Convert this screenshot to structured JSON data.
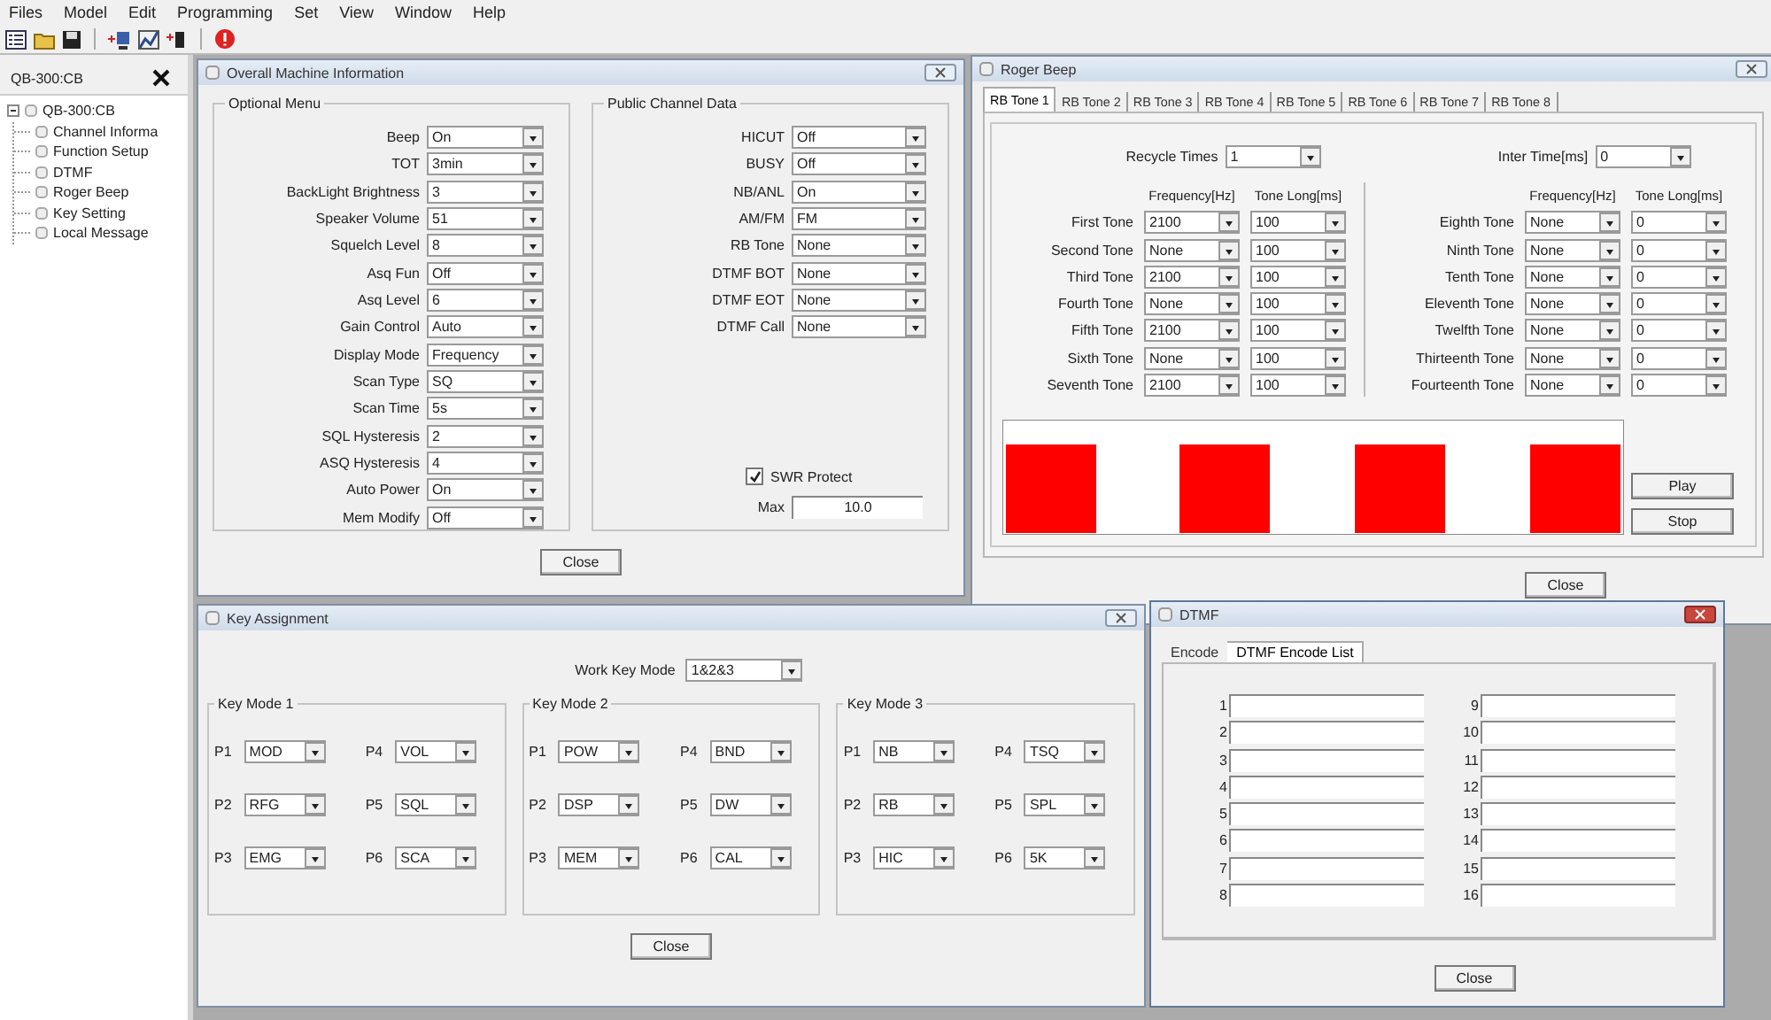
{
  "menu": [
    "Files",
    "Model",
    "Edit",
    "Programming",
    "Set",
    "View",
    "Window",
    "Help"
  ],
  "tree_panel": {
    "title": "QB-300:CB",
    "tree": [
      {
        "label": "QB-300:CB",
        "expanded": true,
        "children": [
          {
            "label": "Channel Informa"
          },
          {
            "label": "Function Setup"
          },
          {
            "label": "DTMF"
          },
          {
            "label": "Roger Beep"
          },
          {
            "label": "Key Setting"
          },
          {
            "label": "Local Message"
          }
        ]
      }
    ]
  },
  "machine_info": {
    "title": "Overall Machine Information",
    "active": false,
    "optional_menu": {
      "title": "Optional Menu",
      "fields": [
        {
          "label": "Beep",
          "value": "On"
        },
        {
          "label": "TOT",
          "value": "3min"
        },
        {
          "label": "BackLight Brightness",
          "value": "3"
        },
        {
          "label": "Speaker Volume",
          "value": "51"
        },
        {
          "label": "Squelch Level",
          "value": "8"
        },
        {
          "label": "Asq Fun",
          "value": "Off"
        },
        {
          "label": "Asq Level",
          "value": "6"
        },
        {
          "label": "Gain Control",
          "value": "Auto"
        },
        {
          "label": "Display Mode",
          "value": "Frequency"
        },
        {
          "label": "Scan Type",
          "value": "SQ"
        },
        {
          "label": "Scan Time",
          "value": "5s"
        },
        {
          "label": "SQL Hysteresis",
          "value": "2"
        },
        {
          "label": "ASQ Hysteresis",
          "value": "4"
        },
        {
          "label": "Auto Power",
          "value": "On"
        },
        {
          "label": "Mem Modify",
          "value": "Off"
        }
      ]
    },
    "public_channel": {
      "title": "Public Channel Data",
      "fields": [
        {
          "label": "HICUT",
          "value": "Off"
        },
        {
          "label": "BUSY",
          "value": "Off"
        },
        {
          "label": "NB/ANL",
          "value": "On"
        },
        {
          "label": "AM/FM",
          "value": "FM"
        },
        {
          "label": "RB Tone",
          "value": "None"
        },
        {
          "label": "DTMF BOT",
          "value": "None"
        },
        {
          "label": "DTMF EOT",
          "value": "None"
        },
        {
          "label": "DTMF Call",
          "value": "None"
        }
      ],
      "swr_protect": {
        "label": "SWR Protect",
        "checked": true
      },
      "max": {
        "label": "Max",
        "value": "10.0"
      }
    },
    "close_button": "Close"
  },
  "roger_beep": {
    "title": "Roger Beep",
    "active": false,
    "tabs": [
      {
        "label": "RB Tone 1",
        "selected": true
      },
      {
        "label": "RB Tone 2",
        "selected": false
      },
      {
        "label": "RB Tone 3",
        "selected": false
      },
      {
        "label": "RB Tone 4",
        "selected": false
      },
      {
        "label": "RB Tone 5",
        "selected": false
      },
      {
        "label": "RB Tone 6",
        "selected": false
      },
      {
        "label": "RB Tone 7",
        "selected": false
      },
      {
        "label": "RB Tone 8",
        "selected": false
      }
    ],
    "recycle_times": {
      "label": "Recycle Times",
      "value": "1"
    },
    "inter_time": {
      "label": "Inter Time[ms]",
      "value": "0"
    },
    "groups": [
      {
        "columns": [
          "Frequency[Hz]",
          "Tone Long[ms]"
        ],
        "rows": [
          {
            "label": "First Tone",
            "frequency": "2100",
            "tone_long": "100"
          },
          {
            "label": "Second Tone",
            "frequency": "None",
            "tone_long": "100"
          },
          {
            "label": "Third Tone",
            "frequency": "2100",
            "tone_long": "100"
          },
          {
            "label": "Fourth Tone",
            "frequency": "None",
            "tone_long": "100"
          },
          {
            "label": "Fifth Tone",
            "frequency": "2100",
            "tone_long": "100"
          },
          {
            "label": "Sixth Tone",
            "frequency": "None",
            "tone_long": "100"
          },
          {
            "label": "Seventh Tone",
            "frequency": "2100",
            "tone_long": "100"
          }
        ]
      },
      {
        "columns": [
          "Frequency[Hz]",
          "Tone Long[ms]"
        ],
        "rows": [
          {
            "label": "Eighth Tone",
            "frequency": "None",
            "tone_long": "0"
          },
          {
            "label": "Ninth Tone",
            "frequency": "None",
            "tone_long": "0"
          },
          {
            "label": "Tenth Tone",
            "frequency": "None",
            "tone_long": "0"
          },
          {
            "label": "Eleventh Tone",
            "frequency": "None",
            "tone_long": "0"
          },
          {
            "label": "Twelfth Tone",
            "frequency": "None",
            "tone_long": "0"
          },
          {
            "label": "Thirteenth Tone",
            "frequency": "None",
            "tone_long": "0"
          },
          {
            "label": "Fourteenth Tone",
            "frequency": "None",
            "tone_long": "0"
          }
        ]
      }
    ],
    "play_button": "Play",
    "stop_button": "Stop",
    "close_button": "Close"
  },
  "key_assignment": {
    "title": "Key Assignment",
    "active": false,
    "work_key_mode": {
      "label": "Work Key Mode",
      "value": "1&2&3"
    },
    "modes": [
      {
        "title": "Key Mode 1",
        "keys": [
          {
            "label": "P1",
            "value": "MOD"
          },
          {
            "label": "P4",
            "value": "VOL"
          },
          {
            "label": "P2",
            "value": "RFG"
          },
          {
            "label": "P5",
            "value": "SQL"
          },
          {
            "label": "P3",
            "value": "EMG"
          },
          {
            "label": "P6",
            "value": "SCA"
          }
        ]
      },
      {
        "title": "Key Mode 2",
        "keys": [
          {
            "label": "P1",
            "value": "POW"
          },
          {
            "label": "P4",
            "value": "BND"
          },
          {
            "label": "P2",
            "value": "DSP"
          },
          {
            "label": "P5",
            "value": "DW"
          },
          {
            "label": "P3",
            "value": "MEM"
          },
          {
            "label": "P6",
            "value": "CAL"
          }
        ]
      },
      {
        "title": "Key Mode 3",
        "keys": [
          {
            "label": "P1",
            "value": "NB"
          },
          {
            "label": "P4",
            "value": "TSQ"
          },
          {
            "label": "P2",
            "value": "RB"
          },
          {
            "label": "P5",
            "value": "SPL"
          },
          {
            "label": "P3",
            "value": "HIC"
          },
          {
            "label": "P6",
            "value": "5K"
          }
        ]
      }
    ],
    "close_button": "Close"
  },
  "dtmf": {
    "title": "DTMF",
    "active": true,
    "tabs": [
      {
        "label": "Encode",
        "selected": false
      },
      {
        "label": "DTMF Encode List",
        "selected": true
      }
    ],
    "entries": [
      "1",
      "2",
      "3",
      "4",
      "5",
      "6",
      "7",
      "8",
      "9",
      "10",
      "11",
      "12",
      "13",
      "14",
      "15",
      "16"
    ],
    "close_button": "Close"
  }
}
